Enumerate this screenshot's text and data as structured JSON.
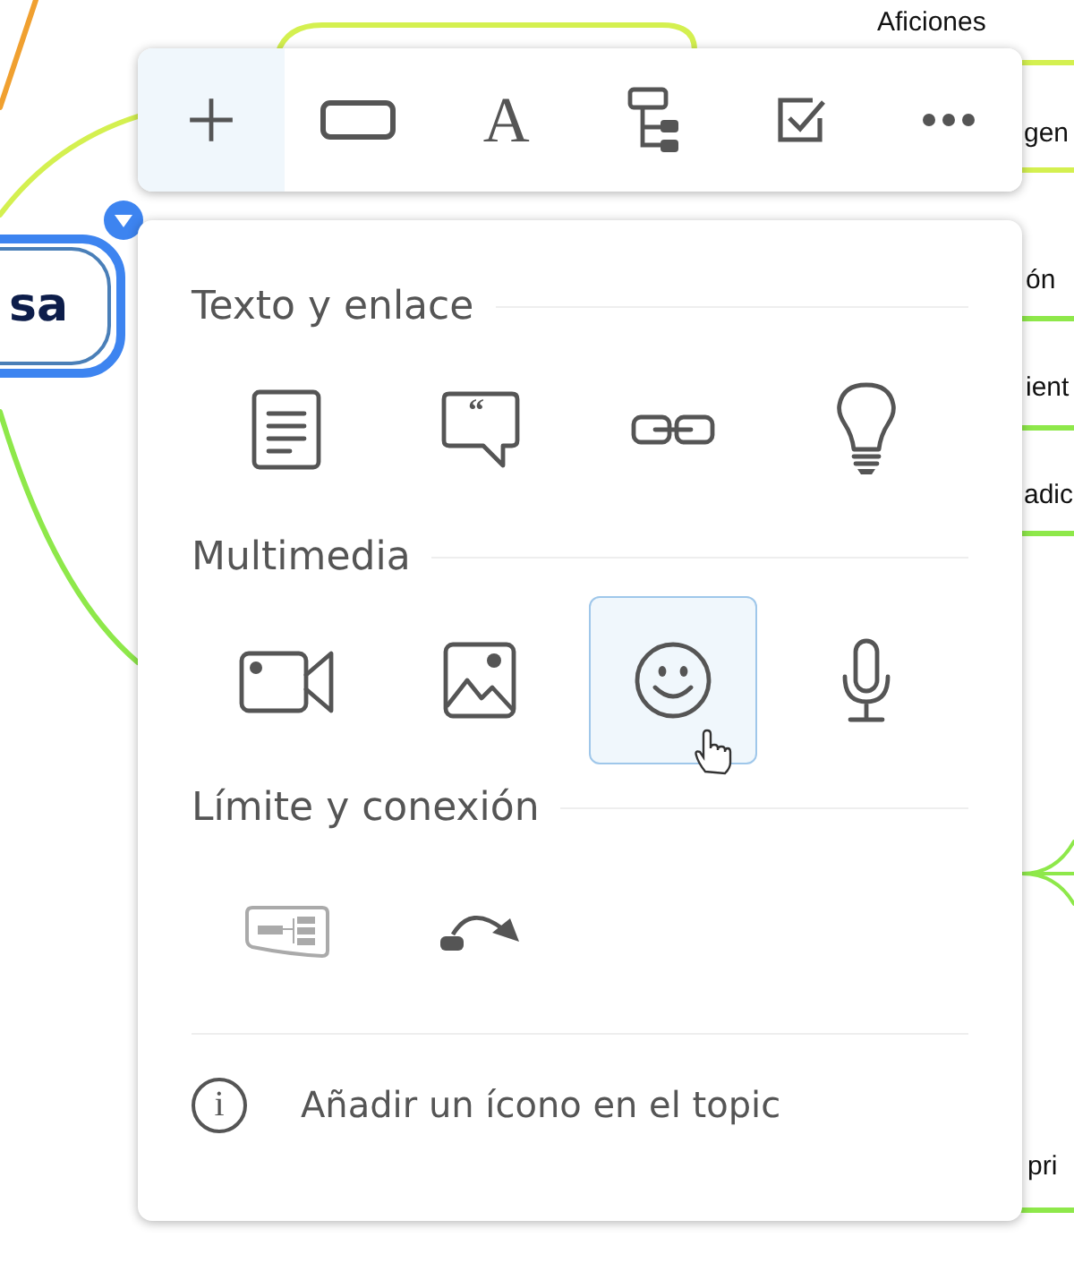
{
  "mind_map": {
    "central_topic": "sa",
    "labels": [
      "Aficiones",
      "gen",
      "ón",
      "ient",
      "adic",
      "pri"
    ]
  },
  "toolbar": {
    "buttons": [
      {
        "kind": "plus",
        "selected": true
      },
      {
        "kind": "shape",
        "selected": false
      },
      {
        "kind": "text",
        "glyph": "A",
        "selected": false
      },
      {
        "kind": "structure",
        "selected": false
      },
      {
        "kind": "task",
        "selected": false
      },
      {
        "kind": "more",
        "selected": false
      }
    ]
  },
  "panel": {
    "sections": [
      {
        "title": "Texto y enlace",
        "items": [
          {
            "kind": "note",
            "selected": false,
            "disabled": false
          },
          {
            "kind": "comment",
            "glyph": "“",
            "selected": false,
            "disabled": false
          },
          {
            "kind": "link",
            "selected": false,
            "disabled": false
          },
          {
            "kind": "idea",
            "selected": false,
            "disabled": false
          }
        ]
      },
      {
        "title": "Multimedia",
        "items": [
          {
            "kind": "video",
            "selected": false,
            "disabled": false
          },
          {
            "kind": "image",
            "selected": false,
            "disabled": false
          },
          {
            "kind": "emoji",
            "selected": true,
            "disabled": false
          },
          {
            "kind": "audio",
            "selected": false,
            "disabled": false
          }
        ]
      },
      {
        "title": "Límite y conexión",
        "items": [
          {
            "kind": "boundary",
            "selected": false,
            "disabled": true
          },
          {
            "kind": "relationship",
            "selected": false,
            "disabled": false
          }
        ]
      }
    ],
    "hint_icon": "i",
    "hint": "Añadir un ícono en el topic"
  }
}
